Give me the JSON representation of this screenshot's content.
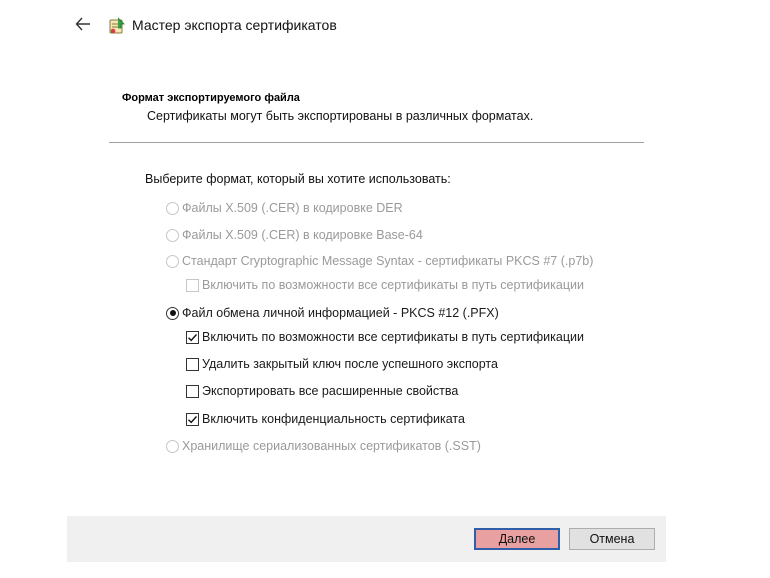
{
  "header": {
    "back_icon": "back-arrow-icon",
    "wizard_icon": "certificate-export-icon",
    "title": "Мастер экспорта сертификатов"
  },
  "section": {
    "title": "Формат экспортируемого файла",
    "subtitle": "Сертификаты могут быть экспортированы в различных форматах."
  },
  "prompt": "Выберите формат, который вы хотите использовать:",
  "options": {
    "der": {
      "label": "Файлы X.509 (.CER) в кодировке DER",
      "checked": false,
      "enabled": false
    },
    "base64": {
      "label": "Файлы X.509 (.CER) в кодировке Base-64",
      "checked": false,
      "enabled": false
    },
    "pkcs7": {
      "label": "Стандарт Cryptographic Message Syntax - сертификаты PKCS #7 (.p7b)",
      "checked": false,
      "enabled": false
    },
    "pkcs7_include_all": {
      "label": "Включить по возможности все сертификаты в путь сертификации",
      "checked": false,
      "enabled": false
    },
    "pfx": {
      "label": "Файл обмена личной информацией - PKCS #12 (.PFX)",
      "checked": true,
      "enabled": true
    },
    "pfx_include_all": {
      "label": "Включить по возможности все сертификаты в путь сертификации",
      "checked": true,
      "enabled": true
    },
    "pfx_delete_key": {
      "label": "Удалить закрытый ключ после успешного экспорта",
      "checked": false,
      "enabled": true
    },
    "pfx_export_ext": {
      "label": "Экспортировать все расширенные свойства",
      "checked": false,
      "enabled": true
    },
    "pfx_privacy": {
      "label": "Включить конфиденциальность сертификата",
      "checked": true,
      "enabled": true
    },
    "sst": {
      "label": "Хранилище сериализованных сертификатов (.SST)",
      "checked": false,
      "enabled": false
    }
  },
  "buttons": {
    "next": "Далее",
    "cancel": "Отмена"
  },
  "colors": {
    "next_button_bg": "#e8a0a0",
    "next_button_border": "#2f5fa8",
    "disabled_text": "#9a9a9a",
    "footer_bg": "#f0f0f0"
  }
}
